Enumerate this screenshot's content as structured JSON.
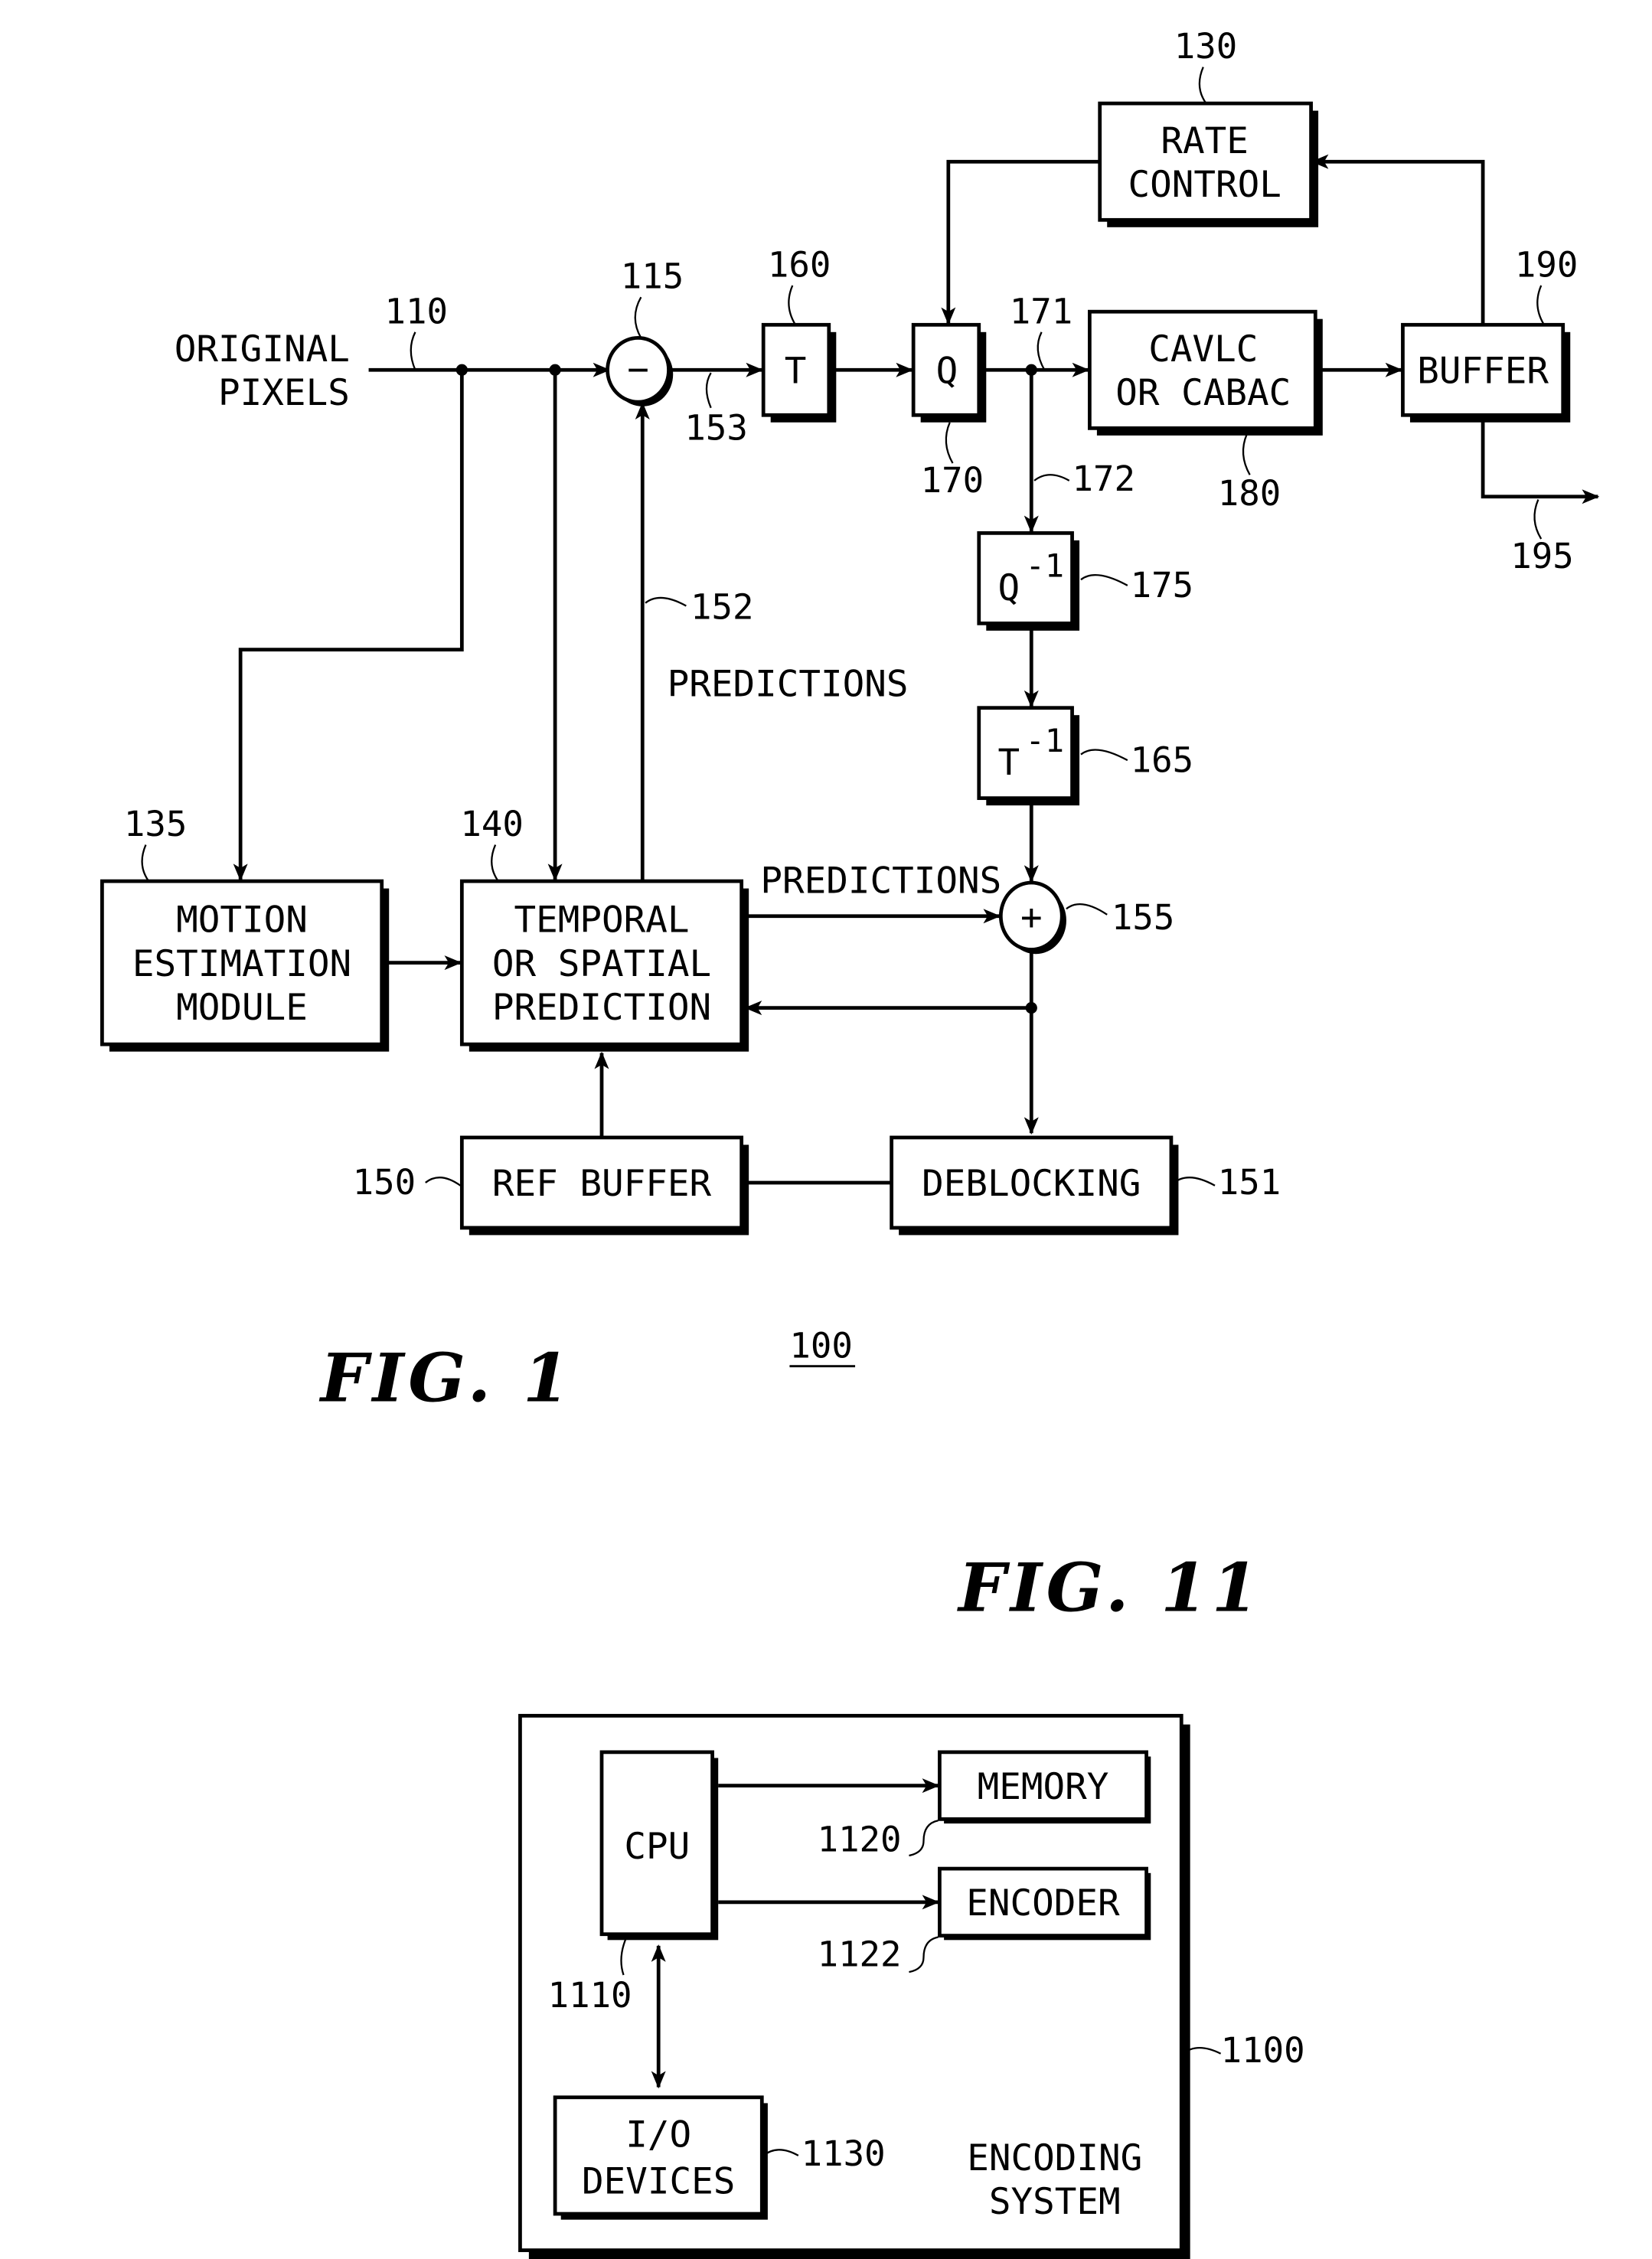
{
  "figure1": {
    "title": "FIG. 1",
    "system_ref": "100",
    "input_label_line1": "ORIGINAL",
    "input_label_line2": "PIXELS",
    "blocks": {
      "rate_control": {
        "ref": "130",
        "line1": "RATE",
        "line2": "CONTROL"
      },
      "transform": {
        "ref": "160",
        "text": "T"
      },
      "quantizer": {
        "ref": "170",
        "text": "Q"
      },
      "entropy_coder": {
        "ref": "180",
        "line1": "CAVLC",
        "line2": "OR CABAC"
      },
      "buffer": {
        "ref": "190",
        "text": "BUFFER"
      },
      "inverse_quantizer": {
        "ref": "175",
        "base": "Q",
        "sup": "-1"
      },
      "inverse_transform": {
        "ref": "165",
        "base": "T",
        "sup": "-1"
      },
      "motion_estimation": {
        "ref": "135",
        "line1": "MOTION",
        "line2": "ESTIMATION",
        "line3": "MODULE"
      },
      "prediction": {
        "ref": "140",
        "line1": "TEMPORAL",
        "line2": "OR SPATIAL",
        "line3": "PREDICTION"
      },
      "ref_buffer": {
        "ref": "150",
        "text": "REF BUFFER"
      },
      "deblocking": {
        "ref": "151",
        "text": "DEBLOCKING"
      }
    },
    "nodes": {
      "subtractor": {
        "ref": "115",
        "symbol": "−"
      },
      "adder": {
        "ref": "155",
        "symbol": "+"
      }
    },
    "signal_refs": {
      "input": "110",
      "residual": "153",
      "prediction_path": "152",
      "quantized_out": "171",
      "recon_path": "172",
      "bitstream_out": "195"
    },
    "edge_labels": {
      "predictions_upper": "PREDICTIONS",
      "predictions_lower": "PREDICTIONS"
    }
  },
  "figure11": {
    "title": "FIG. 11",
    "system_ref": "1100",
    "system_label_line1": "ENCODING",
    "system_label_line2": "SYSTEM",
    "blocks": {
      "cpu": {
        "ref": "1110",
        "text": "CPU"
      },
      "memory": {
        "ref": "1120",
        "text": "MEMORY"
      },
      "encoder": {
        "ref": "1122",
        "text": "ENCODER"
      },
      "io": {
        "ref": "1130",
        "line1": "I/O",
        "line2": "DEVICES"
      }
    }
  }
}
